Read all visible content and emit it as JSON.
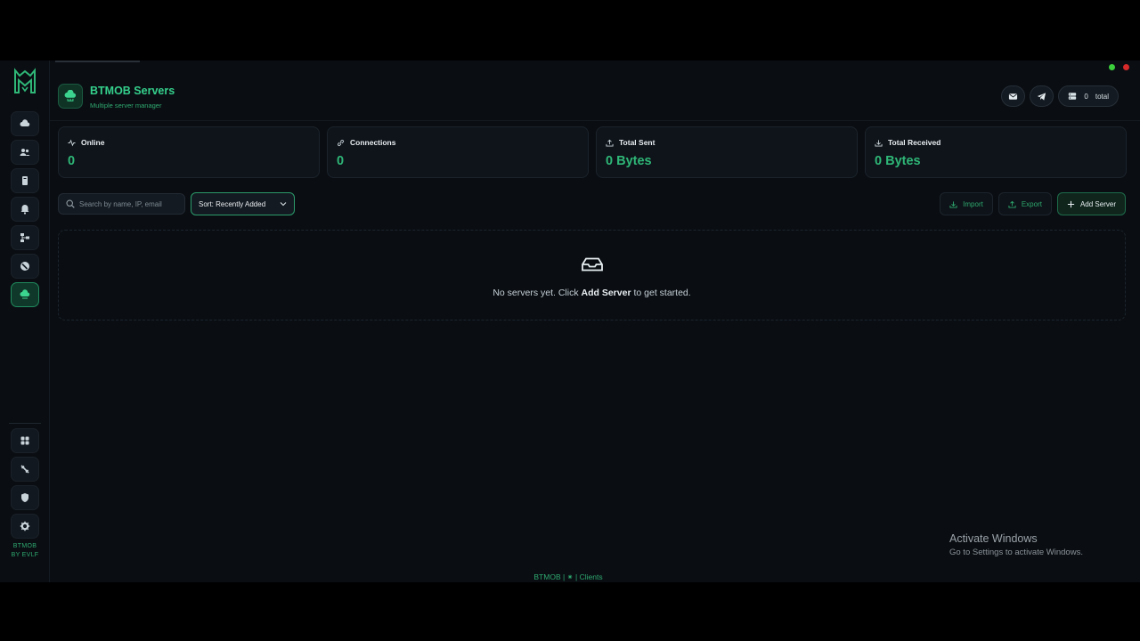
{
  "header": {
    "title": "BTMOB Servers",
    "subtitle": "Multiple server manager",
    "total_count": "0",
    "total_label": "total"
  },
  "sidebar": {
    "footer_line1": "BTMOB",
    "footer_line2": "BY EVLF",
    "items": [
      {
        "icon": "cloud-icon"
      },
      {
        "icon": "users-icon"
      },
      {
        "icon": "device-icon"
      },
      {
        "icon": "bell-icon"
      },
      {
        "icon": "network-icon"
      },
      {
        "icon": "block-icon"
      },
      {
        "icon": "servers-icon",
        "active": true
      }
    ],
    "bottom_items": [
      {
        "icon": "grid-icon"
      },
      {
        "icon": "tools-icon"
      },
      {
        "icon": "shield-icon"
      },
      {
        "icon": "gear-icon"
      }
    ]
  },
  "stats": [
    {
      "label": "Online",
      "value": "0",
      "icon": "activity-icon"
    },
    {
      "label": "Connections",
      "value": "0",
      "icon": "link-icon"
    },
    {
      "label": "Total Sent",
      "value": "0 Bytes",
      "icon": "upload-icon"
    },
    {
      "label": "Total Received",
      "value": "0 Bytes",
      "icon": "download-icon"
    }
  ],
  "toolbar": {
    "search_placeholder": "Search by name, IP, email",
    "sort_label": "Sort: Recently Added",
    "import_label": "Import",
    "export_label": "Export",
    "add_label": "Add Server"
  },
  "empty_state": {
    "text_before": "No servers yet. Click ",
    "text_bold": "Add Server",
    "text_after": " to get started."
  },
  "footer": {
    "text": "BTMOB | ⁕ | Clients"
  },
  "os_overlay": {
    "line1": "Activate Windows",
    "line2": "Go to Settings to activate Windows."
  },
  "colors": {
    "accent": "#2fb777",
    "background": "#0a0e13",
    "window_dot_green": "#3ccf3c",
    "window_dot_red": "#d62a2a"
  }
}
